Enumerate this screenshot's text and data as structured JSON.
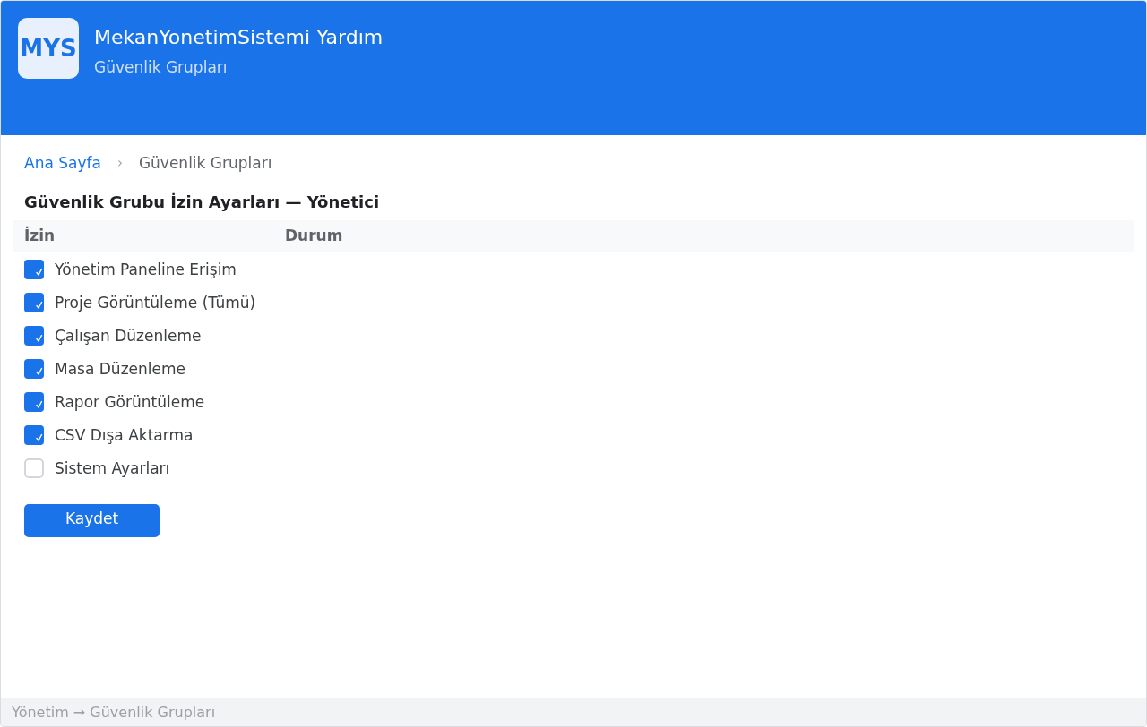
{
  "header": {
    "logo": "MYS",
    "title": "MekanYonetimSistemi Yardım",
    "subtitle": "Güvenlik Grupları"
  },
  "breadcrumb": {
    "separator": "›",
    "items": [
      {
        "label": "Ana Sayfa",
        "kind": "link"
      },
      {
        "label": "Güvenlik Grupları",
        "kind": "current"
      }
    ]
  },
  "heading": "Güvenlik Grubu İzin Ayarları — Yönetici",
  "table": {
    "columns": [
      "İzin",
      "Durum"
    ],
    "rows": [
      {
        "label": "Yönetim Paneline Erişim",
        "checked": true
      },
      {
        "label": "Proje Görüntüleme (Tümü)",
        "checked": true
      },
      {
        "label": "Çalışan Düzenleme",
        "checked": true
      },
      {
        "label": "Masa Düzenleme",
        "checked": true
      },
      {
        "label": "Rapor Görüntüleme",
        "checked": true
      },
      {
        "label": "CSV Dışa Aktarma",
        "checked": true
      },
      {
        "label": "Sistem Ayarları",
        "checked": false
      }
    ]
  },
  "save_button": "Kaydet",
  "status_bar": "Yönetim → Güvenlik Grupları"
}
